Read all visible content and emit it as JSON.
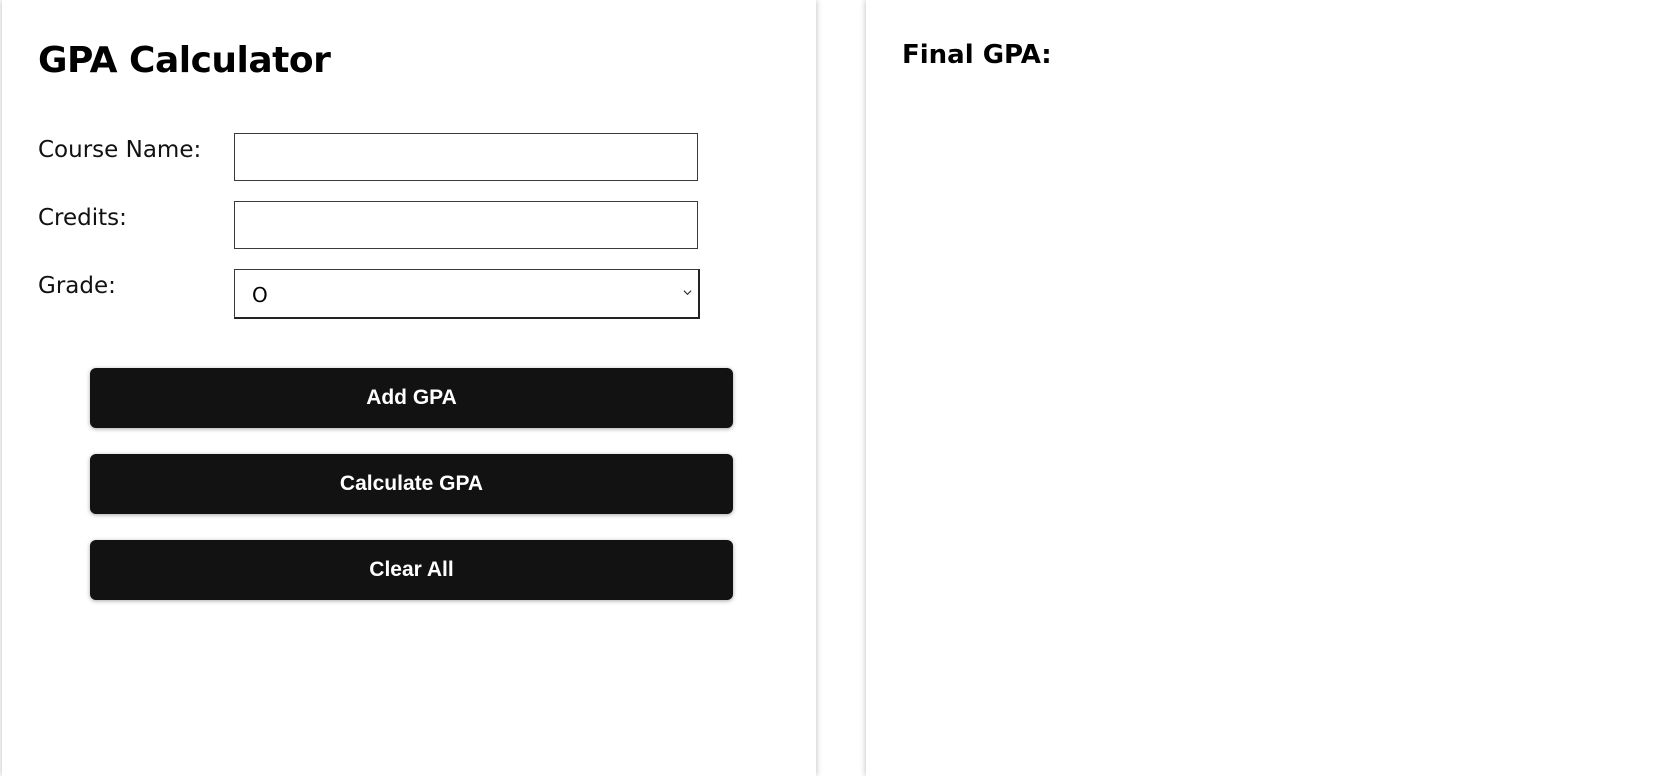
{
  "calculator": {
    "title": "GPA Calculator",
    "fields": {
      "course_name_label": "Course Name:",
      "course_name_value": "",
      "credits_label": "Credits:",
      "credits_value": "",
      "grade_label": "Grade:",
      "grade_selected": "O"
    },
    "buttons": {
      "add_label": "Add GPA",
      "calculate_label": "Calculate GPA",
      "clear_label": "Clear All"
    },
    "colors": {
      "button_bg": "#121212",
      "button_text": "#ffffff"
    }
  },
  "result": {
    "final_gpa_label": "Final GPA:"
  },
  "icons": {
    "grade_dropdown": "chevron-down-icon"
  }
}
